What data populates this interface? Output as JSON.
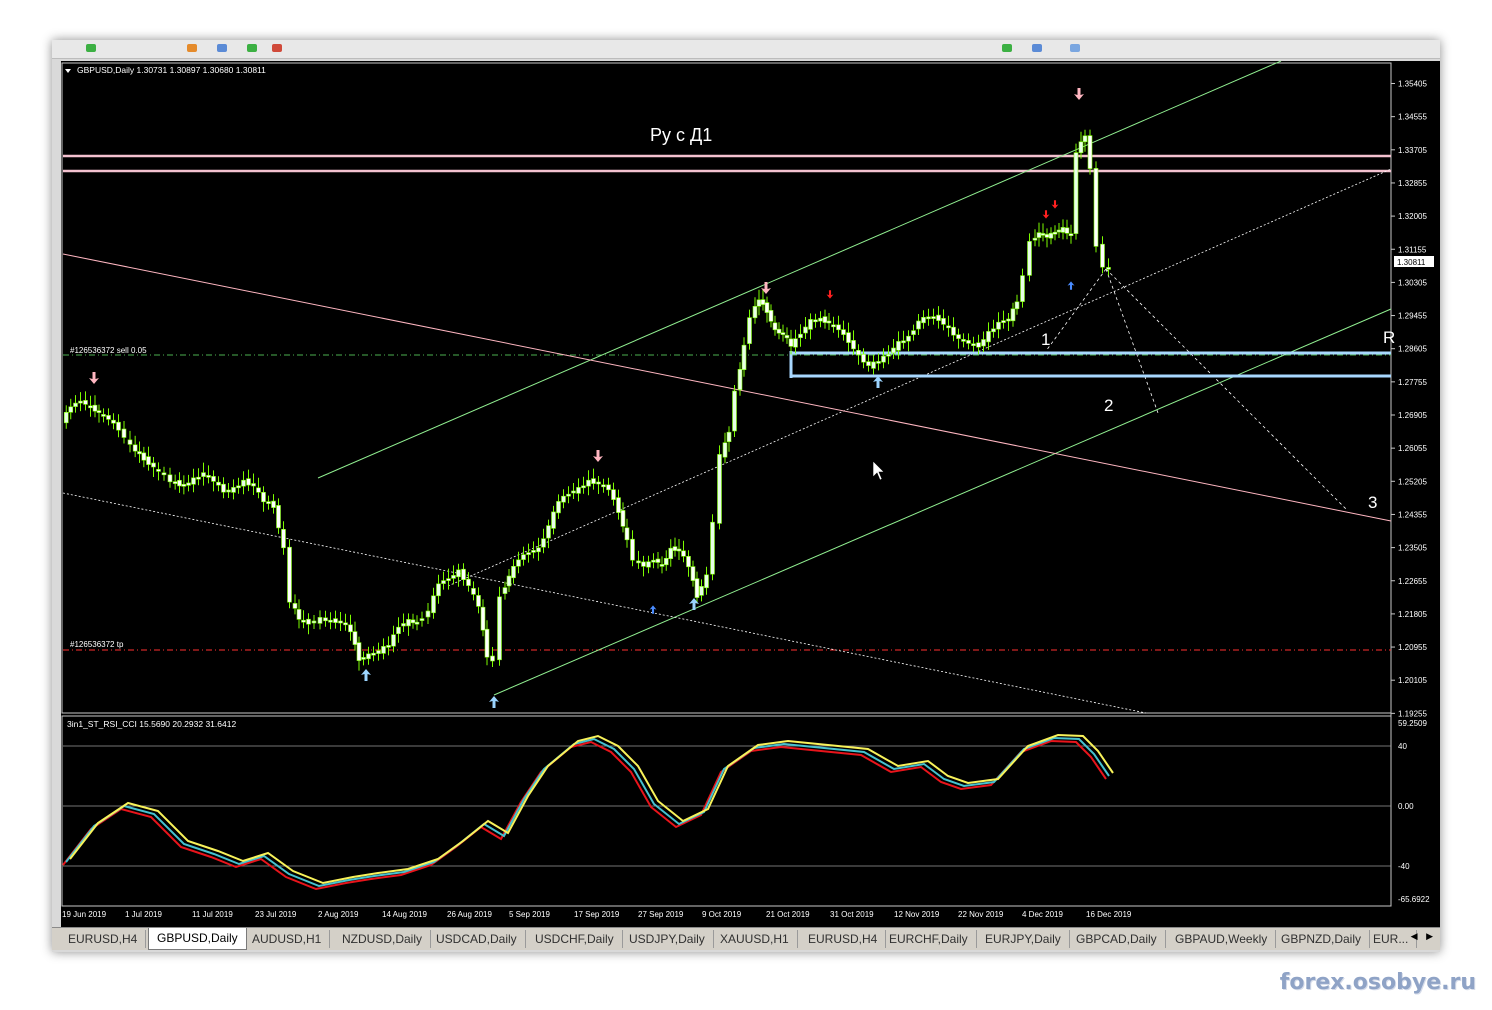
{
  "colors": {
    "background": "#000000",
    "candle_bull": "#e8ffe8",
    "candle_bear": "#ffffff",
    "wick": "#7cfc00",
    "resistance": "#f4c2d0",
    "zone": "#a8d8ff",
    "order_line": "#4caf50",
    "tp_line": "#ff3030",
    "channel": "#90ee90",
    "downtrend": "#ffb6c1",
    "osc_red": "#e8141b",
    "osc_teal": "#46c1cf",
    "osc_yellow": "#f8f25a"
  },
  "main_chart": {
    "header": "GBPUSD,Daily  1.30731 1.30897 1.30680 1.30811",
    "current_price": "1.30811",
    "price_labels": [
      "1.35405",
      "1.34555",
      "1.33705",
      "1.32855",
      "1.32005",
      "1.31155",
      "1.30305",
      "1.29455",
      "1.28605",
      "1.27755",
      "1.26905",
      "1.26055",
      "1.25205",
      "1.24355",
      "1.23505",
      "1.22655",
      "1.21805",
      "1.20955",
      "1.20105",
      "1.19255"
    ],
    "order_label": "#126536372 sell 0.05",
    "tp_label": "#126536372 tp",
    "annotation_title": "Ру с Д1",
    "wave_labels": [
      "1",
      "2",
      "3"
    ],
    "edge_mark": "R"
  },
  "oscillator": {
    "header": "3in1_ST_RSI_CCI 15.5690 20.2932 31.6412",
    "scale_labels": [
      "59.2509",
      "40",
      "0.00",
      "-40",
      "-65.6922"
    ]
  },
  "time_axis": [
    "19 Jun 2019",
    "1 Jul 2019",
    "11 Jul 2019",
    "23 Jul 2019",
    "2 Aug 2019",
    "14 Aug 2019",
    "26 Aug 2019",
    "5 Sep 2019",
    "17 Sep 2019",
    "27 Sep 2019",
    "9 Oct 2019",
    "21 Oct 2019",
    "31 Oct 2019",
    "12 Nov 2019",
    "22 Nov 2019",
    "4 Dec 2019",
    "16 Dec 2019"
  ],
  "tabs": [
    "EURUSD,H4",
    "GBPUSD,Daily",
    "AUDUSD,H1",
    "NZDUSD,Daily",
    "USDCAD,Daily",
    "USDCHF,Daily",
    "USDJPY,Daily",
    "XAUUSD,H1",
    "EURUSD,H4",
    "EURCHF,Daily",
    "EURJPY,Daily",
    "GBPCAD,Daily",
    "GBPAUD,Weekly",
    "GBPNZD,Daily",
    "EUR..."
  ],
  "active_tab": "GBPUSD,Daily",
  "tab_scroll": "◀ ▶",
  "watermark": "forex.osobye.ru"
}
